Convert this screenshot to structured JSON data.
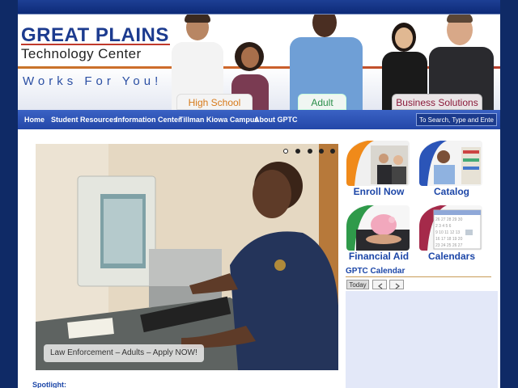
{
  "header": {
    "logo_line1": "GREAT PLAINS",
    "logo_line2": "Technology Center",
    "tagline": "Works For You!",
    "tabs": [
      "High School",
      "Adult",
      "Business Solutions"
    ]
  },
  "nav": {
    "items": [
      "Home",
      "Student Resources",
      "Information Center",
      "Tillman Kiowa Campus",
      "About GPTC"
    ],
    "search_placeholder": "To Search, Type and Enter"
  },
  "slideshow": {
    "caption": "Law Enforcement – Adults – Apply NOW!",
    "dot_count": 5,
    "active_dot": 1
  },
  "quick_links": [
    {
      "label": "Enroll Now",
      "icon": "business-people-image"
    },
    {
      "label": "Catalog",
      "icon": "pharmacy-worker-image"
    },
    {
      "label": "Financial Aid",
      "icon": "piggy-bank-image"
    },
    {
      "label": "Calendars",
      "icon": "calendar-image"
    }
  ],
  "calendar": {
    "title": "GPTC Calendar",
    "today_label": "Today"
  },
  "spotlight": {
    "label": "Spotlight:"
  },
  "colors": {
    "page_bg": "#0f2a66",
    "nav": "#2d52b8",
    "link_blue": "#1d47a8",
    "accent_orange": "#d77a1a"
  }
}
